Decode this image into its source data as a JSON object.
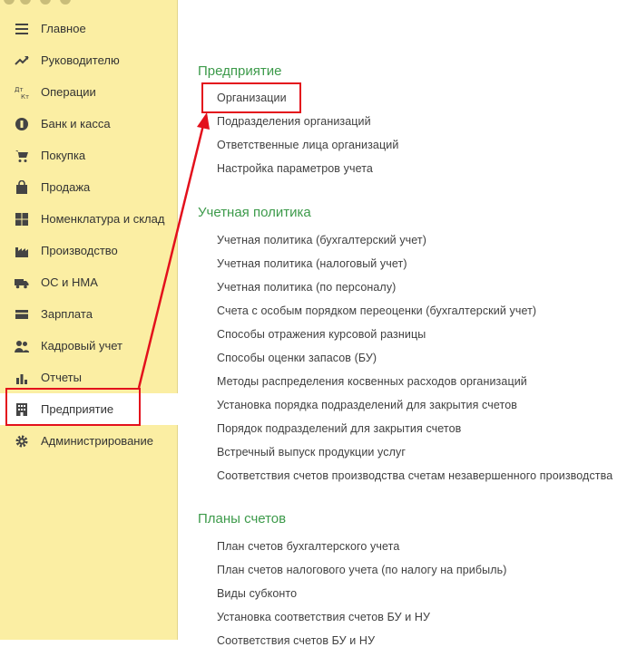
{
  "sidebar": {
    "items": [
      {
        "label": "Главное",
        "icon": "menu-lines-icon"
      },
      {
        "label": "Руководителю",
        "icon": "trend-up-icon"
      },
      {
        "label": "Операции",
        "icon": "debit-credit-icon"
      },
      {
        "label": "Банк и касса",
        "icon": "coin-icon"
      },
      {
        "label": "Покупка",
        "icon": "cart-icon"
      },
      {
        "label": "Продажа",
        "icon": "shopping-bag-icon"
      },
      {
        "label": "Номенклатура и склад",
        "icon": "grid-icon"
      },
      {
        "label": "Производство",
        "icon": "factory-icon"
      },
      {
        "label": "ОС и НМА",
        "icon": "truck-icon"
      },
      {
        "label": "Зарплата",
        "icon": "wallet-icon"
      },
      {
        "label": "Кадровый учет",
        "icon": "people-icon"
      },
      {
        "label": "Отчеты",
        "icon": "bar-chart-icon"
      },
      {
        "label": "Предприятие",
        "icon": "building-icon",
        "active": true
      },
      {
        "label": "Администрирование",
        "icon": "gear-icon"
      }
    ]
  },
  "main": {
    "sections": [
      {
        "title": "Предприятие",
        "links": [
          "Организации",
          "Подразделения организаций",
          "Ответственные лица организаций",
          "Настройка параметров учета"
        ]
      },
      {
        "title": "Учетная политика",
        "links": [
          "Учетная политика (бухгалтерский учет)",
          "Учетная политика (налоговый учет)",
          "Учетная политика (по персоналу)",
          "Счета с особым порядком переоценки (бухгалтерский учет)",
          "Способы отражения курсовой разницы",
          "Способы оценки запасов (БУ)",
          "Методы распределения косвенных расходов организаций",
          "Установка порядка подразделений для закрытия счетов",
          "Порядок подразделений для закрытия счетов",
          "Встречный выпуск продукции услуг",
          "Соответствия счетов производства счетам незавершенного производства"
        ]
      },
      {
        "title": "Планы счетов",
        "links": [
          "План счетов бухгалтерского учета",
          "План счетов налогового учета (по налогу на прибыль)",
          "Виды субконто",
          "Установка соответствия счетов БУ и НУ",
          "Соответствия счетов БУ и НУ"
        ]
      }
    ]
  },
  "colors": {
    "sidebar_bg": "#fbeea3",
    "section_title": "#3c9a4a",
    "link_text": "#404040",
    "highlight": "#e3101c"
  }
}
